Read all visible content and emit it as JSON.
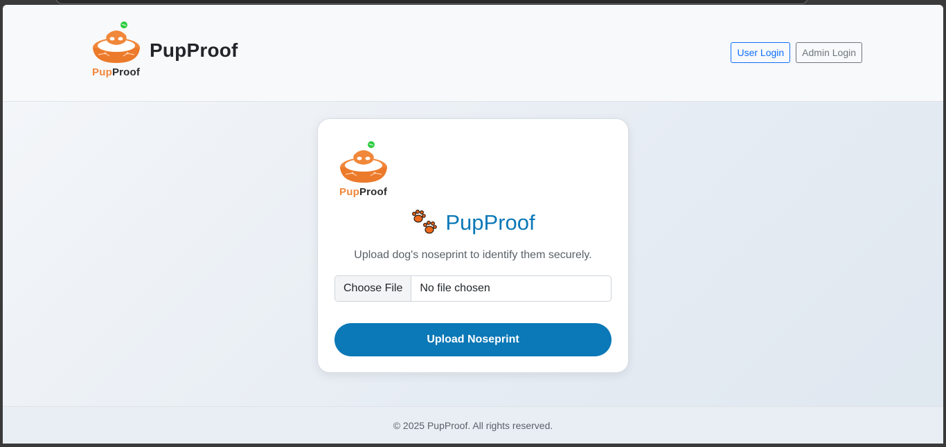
{
  "header": {
    "brand_title": "PupProof",
    "logo_text_pup": "Pup",
    "logo_text_proof": "Proof",
    "user_login_label": "User Login",
    "admin_login_label": "Admin Login"
  },
  "card": {
    "logo_text_pup": "Pup",
    "logo_text_proof": "Proof",
    "title": "PupProof",
    "subtitle": "Upload dog's noseprint to identify them securely.",
    "file_button_label": "Choose File",
    "file_status": "No file chosen",
    "upload_button_label": "Upload Noseprint"
  },
  "footer": {
    "text": "© 2025 PupProof. All rights reserved."
  },
  "colors": {
    "accent": "#0b78b7",
    "logo_orange": "#f0873a",
    "user_login": "#0d6efd",
    "admin_login": "#6c757d"
  },
  "icons": [
    "pupproof-logo-icon",
    "paw-prints-icon"
  ]
}
